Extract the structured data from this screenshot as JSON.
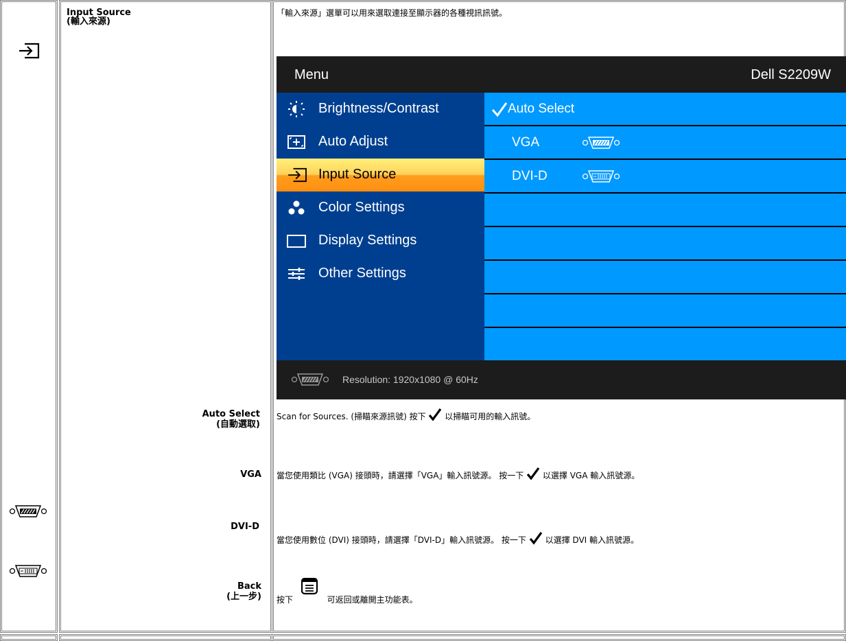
{
  "section": {
    "title": "Input Source",
    "title_zh": "(輸入來源)",
    "description": "「輸入來源」選單可以用來選取連接至顯示器的各種視訊訊號。"
  },
  "osd": {
    "header_left": "Menu",
    "header_right": "Dell S2209W",
    "menu_items": [
      {
        "label": "Brightness/Contrast",
        "icon": "sun-icon"
      },
      {
        "label": "Auto Adjust",
        "icon": "auto-adjust-icon"
      },
      {
        "label": "Input Source",
        "icon": "input-source-icon",
        "selected": true
      },
      {
        "label": "Color Settings",
        "icon": "color-dots-icon"
      },
      {
        "label": "Display Settings",
        "icon": "display-rect-icon"
      },
      {
        "label": "Other Settings",
        "icon": "sliders-icon"
      }
    ],
    "submenu": [
      {
        "label": "Auto Select",
        "checked": true
      },
      {
        "label": "VGA",
        "icon": "vga-connector-icon"
      },
      {
        "label": "DVI-D",
        "icon": "dvi-connector-icon"
      }
    ],
    "footer": "Resolution: 1920x1080 @ 60Hz"
  },
  "rows": {
    "auto_select": {
      "label": "Auto Select",
      "label_zh": "(自動選取)",
      "desc_a": "Scan for Sources. (掃瞄來源訊號) 按下",
      "desc_b": "以掃瞄可用的輸入訊號。"
    },
    "vga": {
      "label": "VGA",
      "desc_a": "當您使用類比 (VGA) 接頭時，請選擇「VGA」輸入訊號源。 按一下",
      "desc_b": "以選擇 VGA 輸入訊號源。"
    },
    "dvi": {
      "label": "DVI-D",
      "desc_a": "當您使用數位 (DVI) 接頭時，請選擇「DVI-D」輸入訊號源。 按一下",
      "desc_b": "以選擇 DVI 輸入訊號源。"
    },
    "back": {
      "label": "Back",
      "label_zh": "(上一步)",
      "desc_a": "按下",
      "desc_b": "可返回或離開主功能表。"
    }
  }
}
